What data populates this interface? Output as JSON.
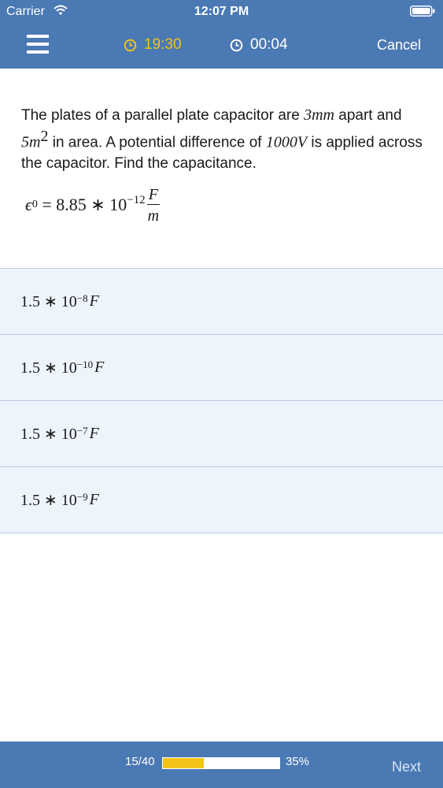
{
  "status_bar": {
    "carrier": "Carrier",
    "time": "12:07 PM"
  },
  "header": {
    "timer_remaining": "19:30",
    "timer_elapsed": "00:04",
    "cancel_label": "Cancel"
  },
  "question": {
    "text_1": "The plates of a parallel plate capacitor are ",
    "m1": "3mm",
    "text_2": " apart and ",
    "m2_base": "5m",
    "m2_exp": "2",
    "text_3": " in area. A potential difference of ",
    "m3": "1000V",
    "text_4": " is applied across the capacitor. Find the capacitance.",
    "formula": {
      "lhs": "ϵ",
      "lhs_sub": "0",
      "rhs": " = 8.85 ∗ 10",
      "exp": "−12",
      "frac_num": "F",
      "frac_den": "m"
    }
  },
  "options": [
    {
      "coef": "1.5 ∗ 10",
      "exp": "−8",
      "unit": "F"
    },
    {
      "coef": "1.5 ∗ 10",
      "exp": "−10",
      "unit": "F"
    },
    {
      "coef": "1.5 ∗ 10",
      "exp": "−7",
      "unit": "F"
    },
    {
      "coef": "1.5 ∗ 10",
      "exp": "−9",
      "unit": "F"
    }
  ],
  "footer": {
    "progress_count": "15/40",
    "progress_percent": "35%",
    "progress_value": 0.35,
    "next_label": "Next"
  },
  "colors": {
    "bar": "#4a79b4",
    "accent": "#f2c318",
    "option_bg": "#eef4fc"
  },
  "icons": {
    "menu": "hamburger-menu-icon",
    "clock": "clock-icon",
    "wifi": "wifi-icon",
    "battery": "battery-icon"
  }
}
